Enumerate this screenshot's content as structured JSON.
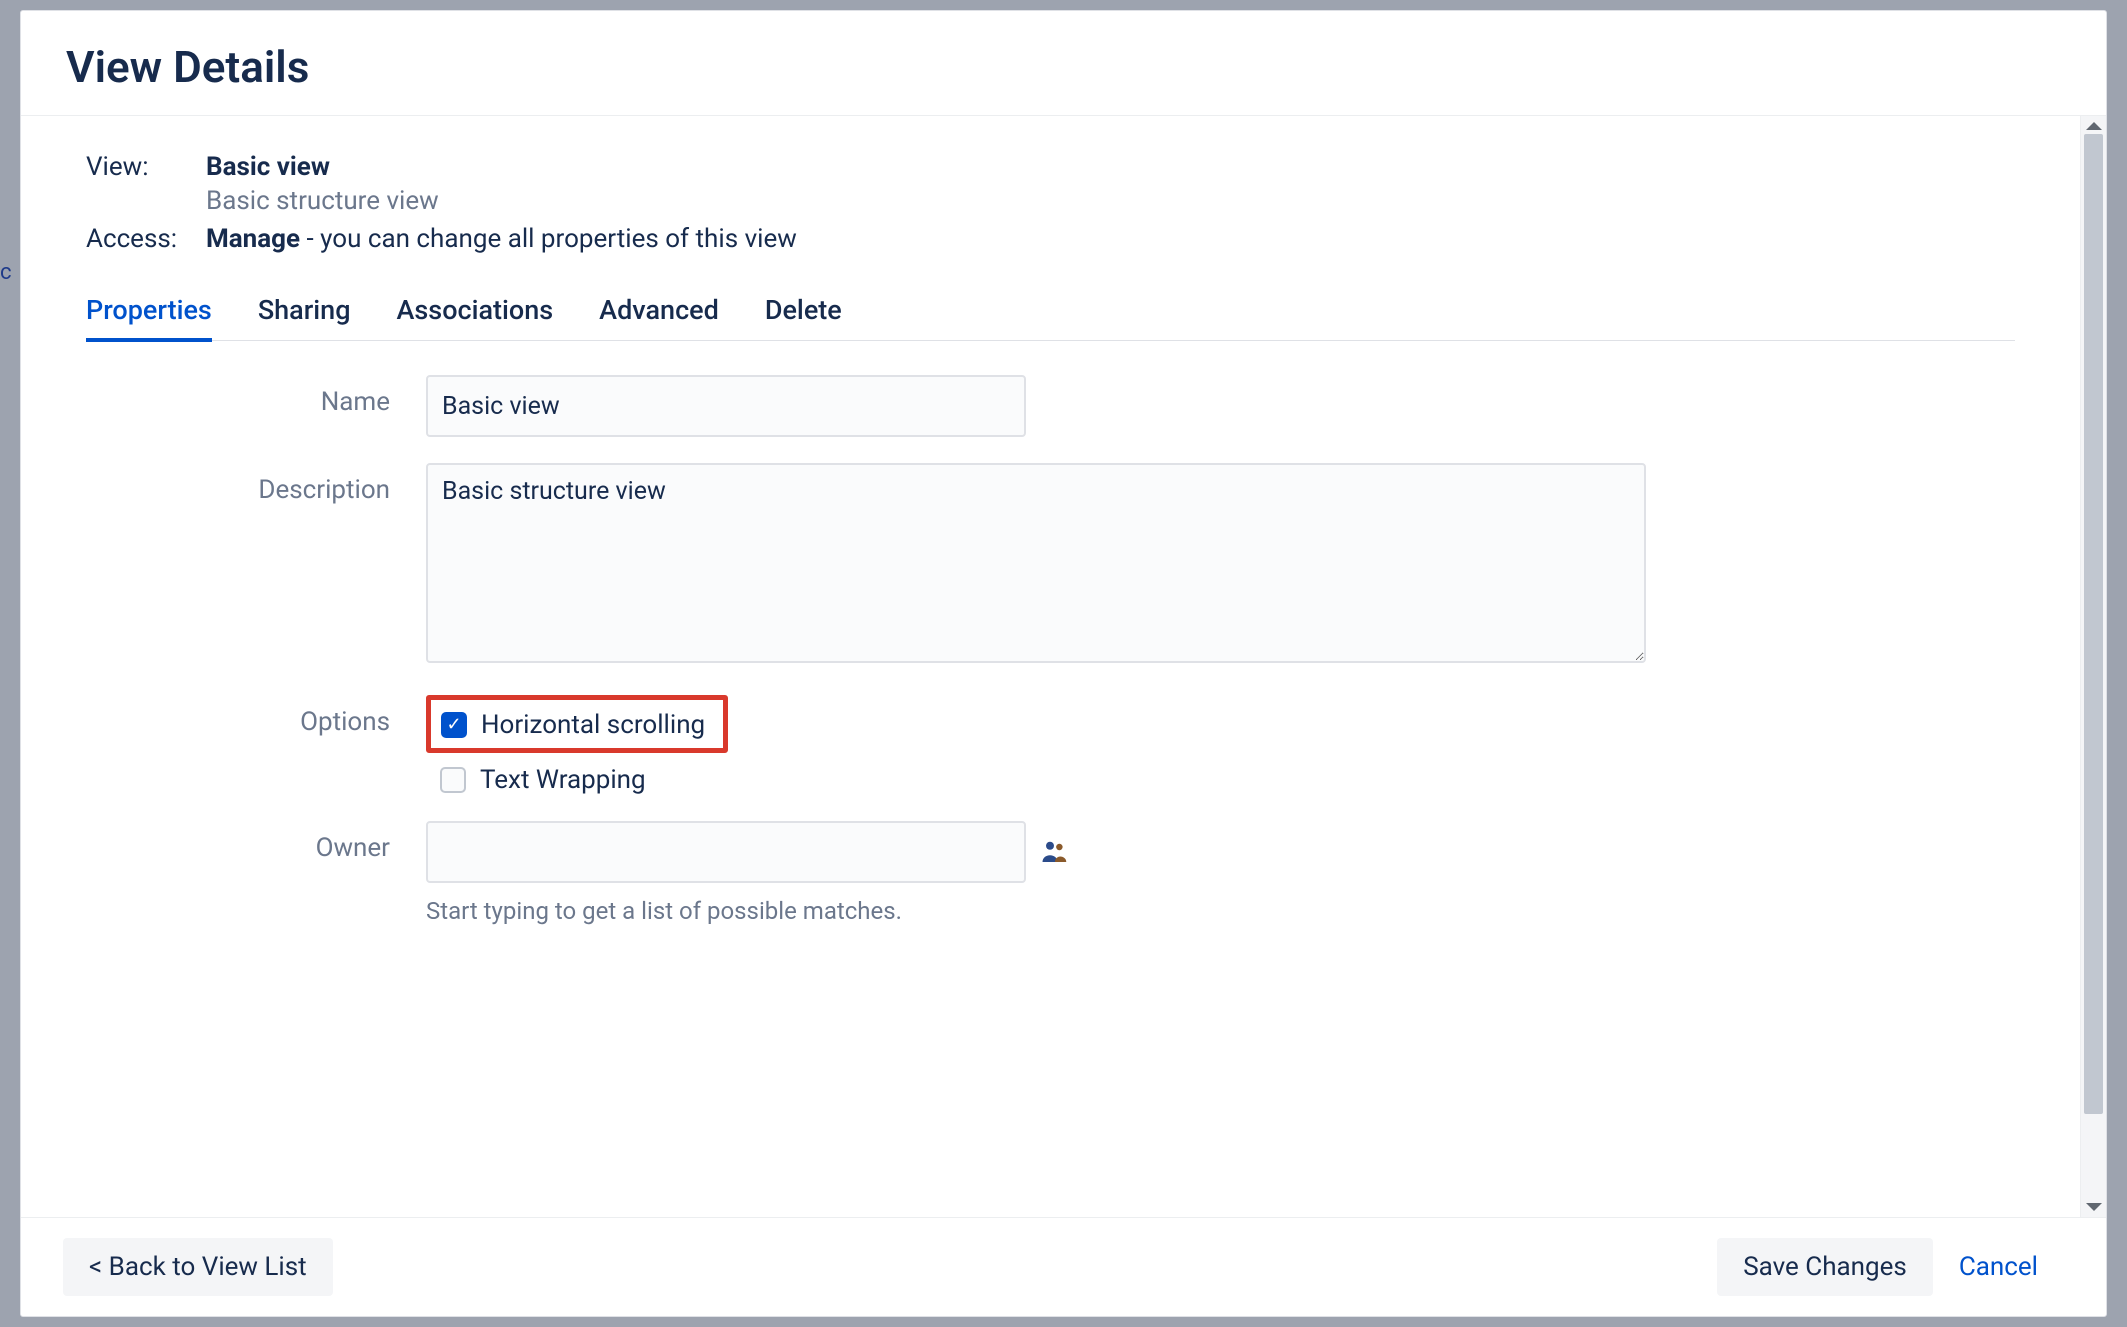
{
  "header": {
    "title": "View Details"
  },
  "meta": {
    "view_label": "View:",
    "view_name": "Basic view",
    "view_description": "Basic structure view",
    "access_label": "Access:",
    "access_level": "Manage",
    "access_suffix": " - you can change all properties of this view"
  },
  "tabs": [
    {
      "label": "Properties",
      "active": true
    },
    {
      "label": "Sharing",
      "active": false
    },
    {
      "label": "Associations",
      "active": false
    },
    {
      "label": "Advanced",
      "active": false
    },
    {
      "label": "Delete",
      "active": false
    }
  ],
  "form": {
    "name_label": "Name",
    "name_value": "Basic view",
    "description_label": "Description",
    "description_value": "Basic structure view",
    "options_label": "Options",
    "option_horizontal_scrolling": "Horizontal scrolling",
    "option_text_wrapping": "Text Wrapping",
    "owner_label": "Owner",
    "owner_value": "",
    "owner_helper": "Start typing to get a list of possible matches."
  },
  "footer": {
    "back": "< Back to View List",
    "save": "Save Changes",
    "cancel": "Cancel"
  },
  "colors": {
    "accent": "#0052cc",
    "highlight_border": "#d9392c",
    "text": "#172b4d",
    "muted": "#6b778c"
  }
}
